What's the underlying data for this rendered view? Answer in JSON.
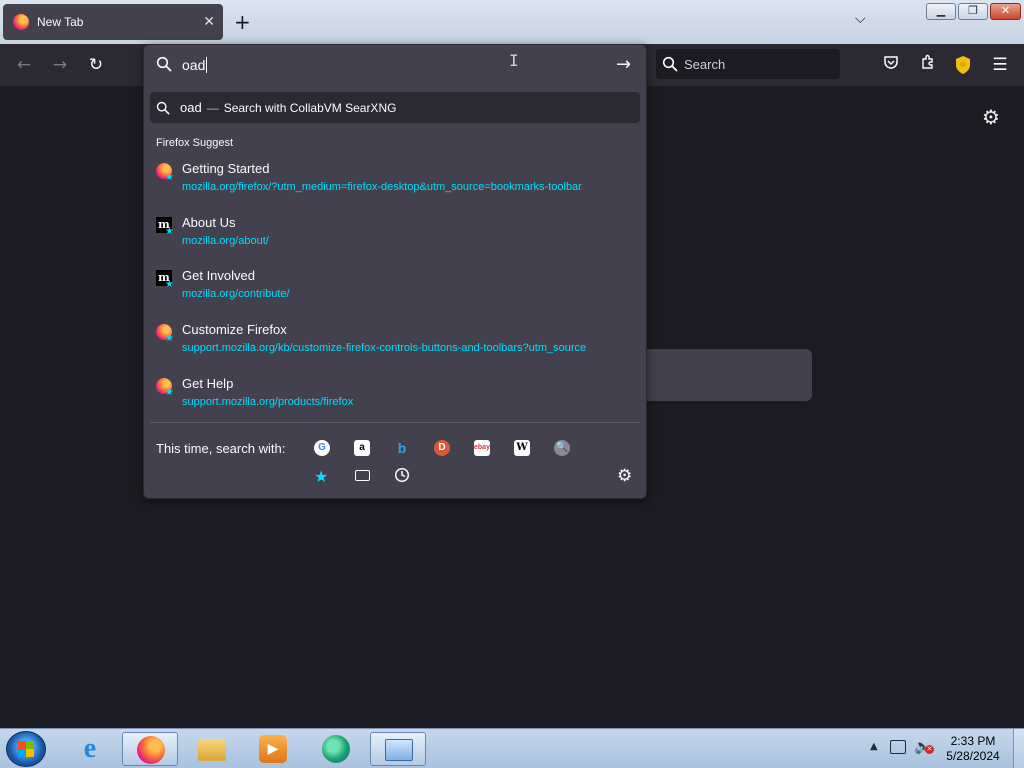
{
  "window": {
    "tab_title": "New Tab",
    "tab_close": "✕",
    "new_tab": "+",
    "list_tabs": "⌵",
    "minimize": "▁",
    "maximize": "❐",
    "close": "✕"
  },
  "toolbar": {
    "back": "←",
    "forward": "→",
    "reload": "↻",
    "search_placeholder": "Search",
    "menu": "☰"
  },
  "urlbar": {
    "value": "oad",
    "go": "→",
    "cursor": "I",
    "heuristic": {
      "query": "oad",
      "dash": "—",
      "action": "Search with CollabVM SearXNG"
    },
    "suggest_header": "Firefox Suggest",
    "suggestions": [
      {
        "title": "Getting Started",
        "url": "mozilla.org/firefox/?utm_medium=firefox-desktop&utm_source=bookmarks-toolbar",
        "icon": "firefox-icon",
        "bookmarked": true
      },
      {
        "title": "About Us",
        "url": "mozilla.org/about/",
        "icon": "mozilla-icon",
        "bookmarked": true
      },
      {
        "title": "Get Involved",
        "url": "mozilla.org/contribute/",
        "icon": "mozilla-icon",
        "bookmarked": true
      },
      {
        "title": "Customize Firefox",
        "url": "support.mozilla.org/kb/customize-firefox-controls-buttons-and-toolbars?utm_source",
        "icon": "firefox-icon",
        "bookmarked": true
      },
      {
        "title": "Get Help",
        "url": "support.mozilla.org/products/firefox",
        "icon": "firefox-icon",
        "bookmarked": true
      }
    ],
    "oneoff_label": "This time, search with:",
    "engines": [
      {
        "name": "google-icon",
        "glyph": "G"
      },
      {
        "name": "amazon-icon",
        "glyph": "a"
      },
      {
        "name": "bing-icon",
        "glyph": "b"
      },
      {
        "name": "duckduckgo-icon",
        "glyph": "D"
      },
      {
        "name": "ebay-icon",
        "glyph": "ebay"
      },
      {
        "name": "wikipedia-icon",
        "glyph": "W"
      },
      {
        "name": "searxng-icon",
        "glyph": "🔍"
      }
    ],
    "mode_bookmarks": "★",
    "mode_history": "🕒",
    "settings": "⚙"
  },
  "newtab": {
    "settings": "⚙"
  },
  "taskbar": {
    "clock_time": "2:33 PM",
    "clock_date": "5/28/2024",
    "tray_arrow": "▲",
    "volume": "🔈",
    "volume_muted": "✕",
    "media_glyph": "▶",
    "ie_glyph": "e"
  },
  "colors": {
    "accent_link": "#00ddff",
    "panel_bg": "#42414d",
    "toolbar_bg": "#2b2a33",
    "page_bg": "#1c1b22"
  }
}
